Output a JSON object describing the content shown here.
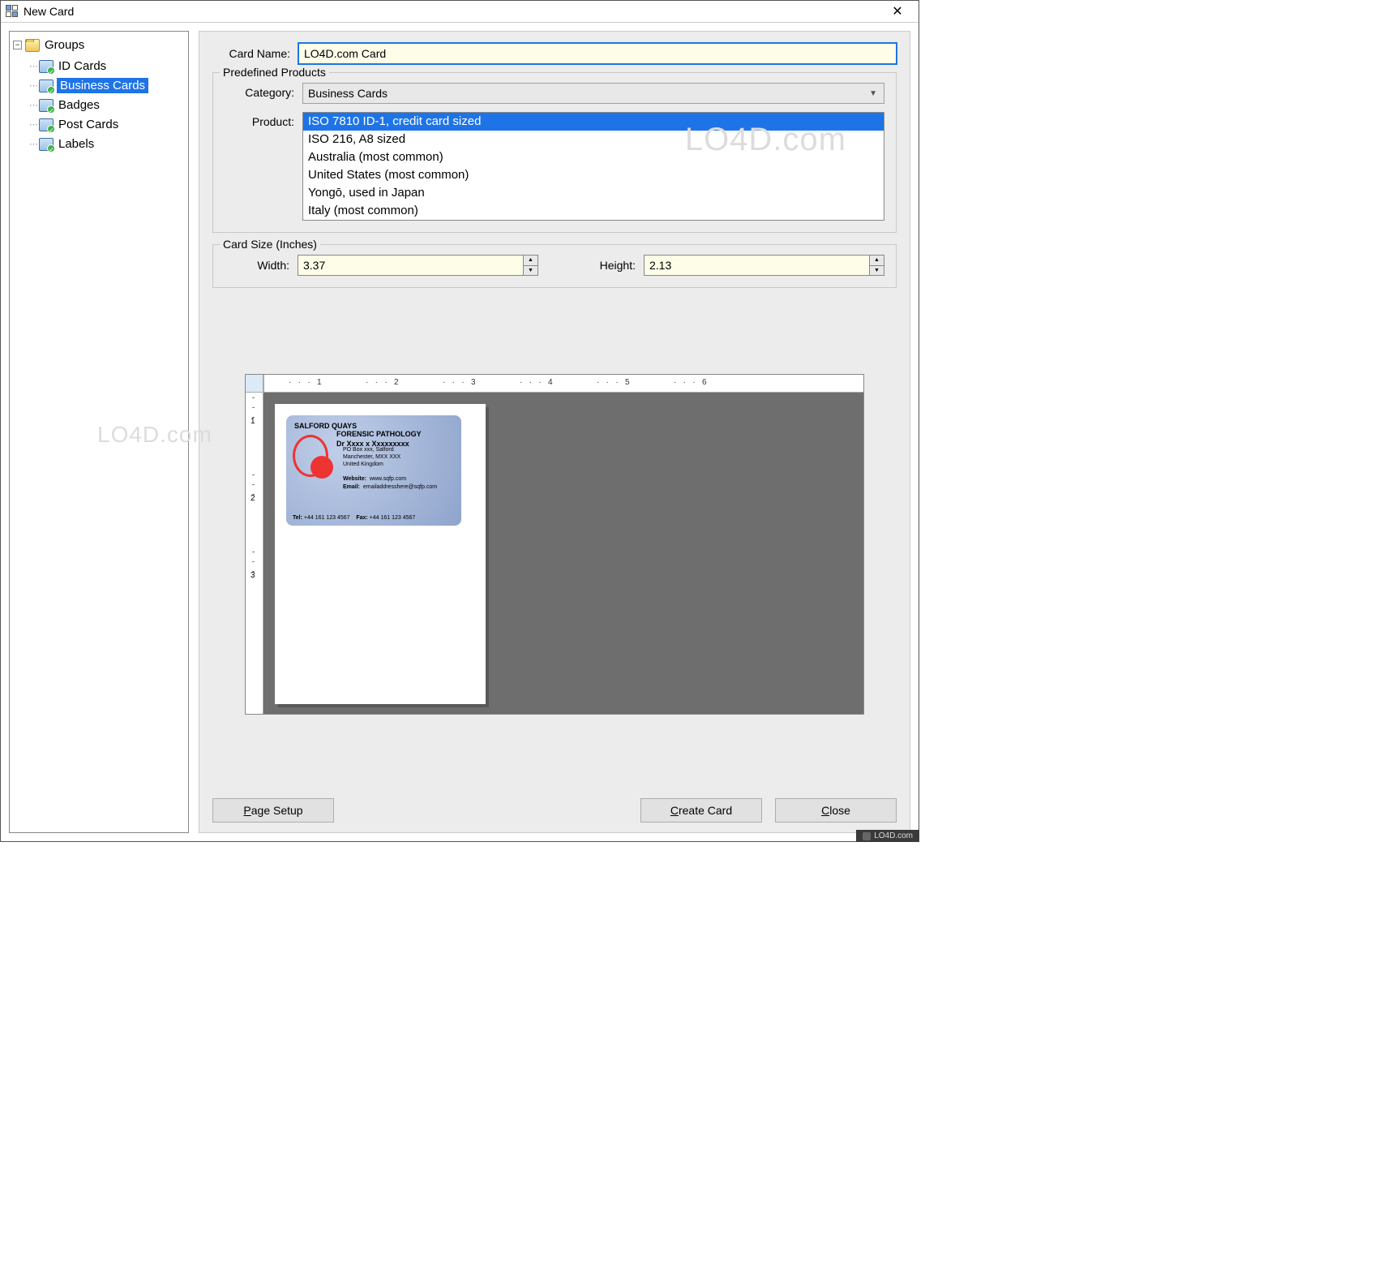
{
  "window": {
    "title": "New Card"
  },
  "tree": {
    "root": "Groups",
    "items": [
      {
        "label": "ID Cards"
      },
      {
        "label": "Business Cards",
        "selected": true
      },
      {
        "label": "Badges"
      },
      {
        "label": "Post Cards"
      },
      {
        "label": "Labels"
      }
    ]
  },
  "form": {
    "card_name_label": "Card Name:",
    "card_name_value": "LO4D.com Card"
  },
  "predefined": {
    "legend": "Predefined Products",
    "category_label": "Category:",
    "category_value": "Business Cards",
    "product_label": "Product:",
    "products": [
      "ISO 7810 ID-1, credit card sized",
      "ISO 216, A8 sized",
      "Australia (most common)",
      "United States (most common)",
      "Yongō, used in Japan",
      "Italy (most common)"
    ],
    "product_selected_index": 0
  },
  "card_size": {
    "legend": "Card Size (Inches)",
    "width_label": "Width:",
    "width_value": "3.37",
    "height_label": "Height:",
    "height_value": "2.13"
  },
  "preview_card": {
    "line1": "SALFORD QUAYS",
    "line2": "FORENSIC PATHOLOGY",
    "name": "Dr Xxxx x Xxxxxxxxx",
    "addr1": "PO Box xxx, Salford",
    "addr2": "Manchester, MXX XXX",
    "addr3": "United Kingdom",
    "web_l": "Website:",
    "web_v": "www.sqfp.com",
    "em_l": "Email:",
    "em_v": "emailaddresshere@sqfp.com",
    "tel_l": "Tel:",
    "tel_v": "+44 161 123 4567",
    "fax_l": "Fax:",
    "fax_v": "+44 161 123 4567"
  },
  "ruler": {
    "h": [
      "1",
      "2",
      "3",
      "4",
      "5",
      "6"
    ],
    "v": [
      "1",
      "2",
      "3"
    ]
  },
  "buttons": {
    "page_setup": "age Setup",
    "create_card": "reate Card",
    "close": "lose",
    "page_setup_u": "P",
    "create_card_u": "C",
    "close_u": "C"
  },
  "footer": "LO4D.com",
  "watermark": "LO4D.com"
}
